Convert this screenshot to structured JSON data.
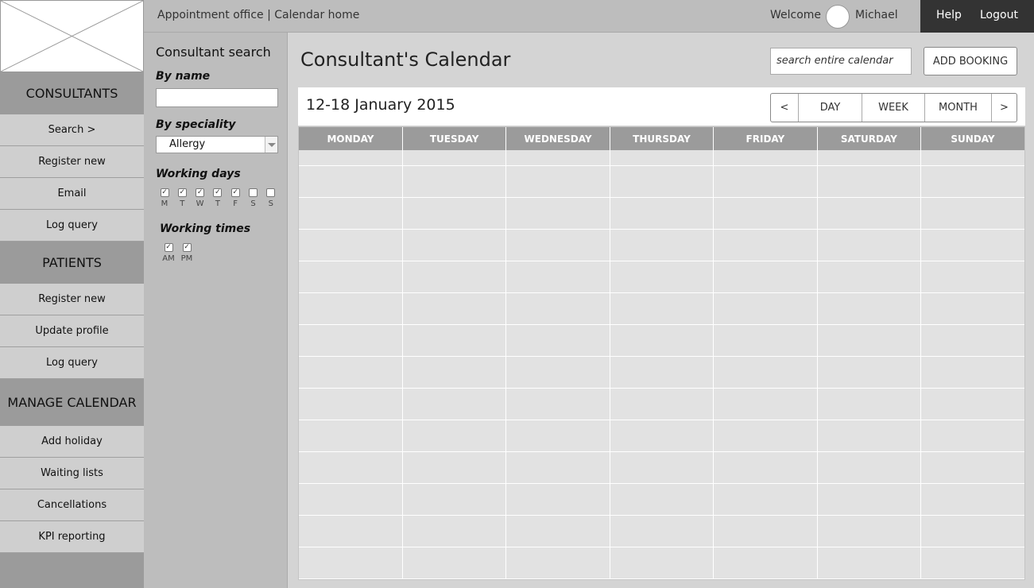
{
  "header": {
    "breadcrumb": "Appointment office | Calendar home",
    "welcome": "Welcome",
    "username": "Michael",
    "help": "Help",
    "logout": "Logout"
  },
  "nav": {
    "consultants_header": "CONSULTANTS",
    "consultants_items": [
      "Search >",
      "Register new",
      "Email",
      "Log query"
    ],
    "patients_header": "PATIENTS",
    "patients_items": [
      "Register new",
      "Update profile",
      "Log query"
    ],
    "calendar_header": "MANAGE CALENDAR",
    "calendar_items": [
      "Add holiday",
      "Waiting lists",
      "Cancellations",
      "KPI reporting"
    ]
  },
  "search_panel": {
    "title": "Consultant search",
    "by_name": "By name",
    "name_value": "",
    "by_speciality": "By speciality",
    "speciality_value": "Allergy",
    "working_days": "Working days",
    "days": [
      {
        "label": "M",
        "checked": true
      },
      {
        "label": "T",
        "checked": true
      },
      {
        "label": "W",
        "checked": true
      },
      {
        "label": "T",
        "checked": true
      },
      {
        "label": "F",
        "checked": true
      },
      {
        "label": "S",
        "checked": false
      },
      {
        "label": "S",
        "checked": false
      }
    ],
    "working_times": "Working times",
    "times": [
      {
        "label": "AM",
        "checked": true
      },
      {
        "label": "PM",
        "checked": true
      }
    ]
  },
  "main": {
    "title": "Consultant's Calendar",
    "search_placeholder": "search entire calendar",
    "add_booking": "ADD BOOKING",
    "date_range": "12-18 January 2015",
    "view_buttons": [
      "<",
      "DAY",
      "WEEK",
      "MONTH",
      ">"
    ],
    "weekdays": [
      "MONDAY",
      "TUESDAY",
      "WEDNESDAY",
      "THURSDAY",
      "FRIDAY",
      "SATURDAY",
      "SUNDAY"
    ]
  }
}
